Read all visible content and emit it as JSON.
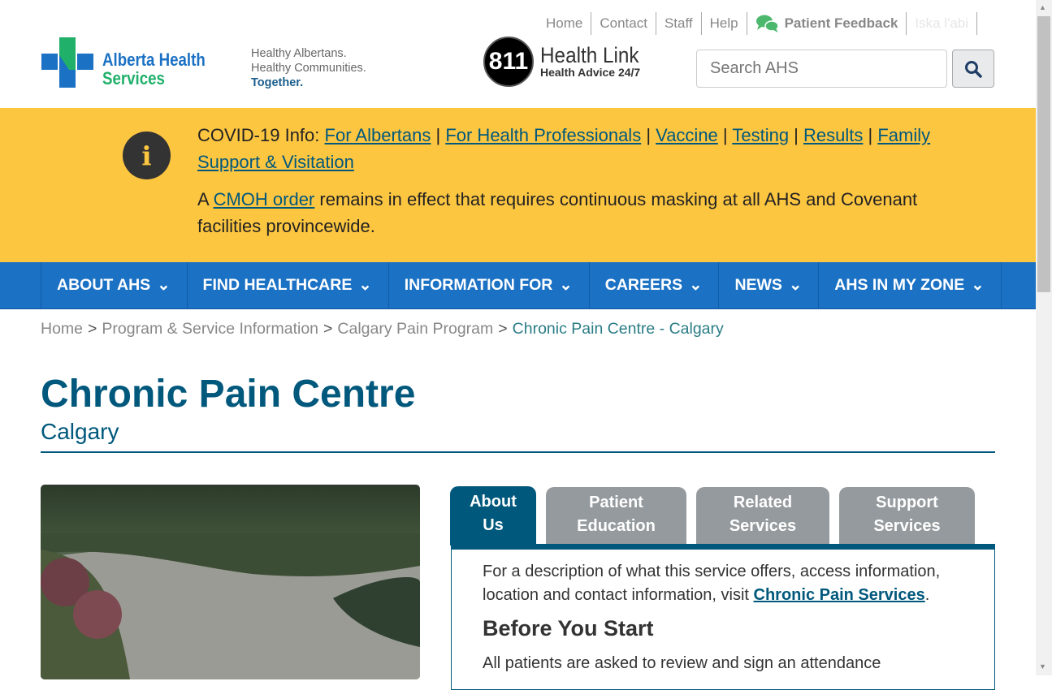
{
  "top_links": [
    "Home",
    "Contact",
    "Staff",
    "Help"
  ],
  "feedback": "Patient Feedback",
  "language": "Iska l'abi",
  "logo": {
    "line1": "Alberta Health",
    "line2": "Services"
  },
  "tagline": [
    "Healthy Albertans.",
    "Healthy Communities.",
    "Together."
  ],
  "healthlink": {
    "number": "811",
    "title": "Health Link",
    "sub": "Health Advice 24/7"
  },
  "search": {
    "placeholder": "Search AHS"
  },
  "banner": {
    "prefix": "COVID-19 Info: ",
    "links": [
      "For Albertans",
      "For Health Professionals",
      "Vaccine",
      "Testing",
      "Results",
      "Family Support & Visitation"
    ],
    "p2_a": "A ",
    "p2_link": "CMOH order",
    "p2_b": " remains in effect that requires continuous masking at all AHS and Covenant facilities provincewide."
  },
  "nav": [
    "ABOUT AHS",
    "FIND HEALTHCARE",
    "INFORMATION FOR",
    "CAREERS",
    "NEWS",
    "AHS IN MY ZONE"
  ],
  "breadcrumb": [
    "Home",
    "Program & Service Information",
    "Calgary Pain Program",
    "Chronic Pain Centre - Calgary"
  ],
  "page": {
    "title": "Chronic Pain Centre",
    "subtitle": "Calgary"
  },
  "tabs": [
    [
      "About",
      "Us"
    ],
    [
      "Patient",
      "Education"
    ],
    [
      "Related",
      "Services"
    ],
    [
      "Support",
      "Services"
    ]
  ],
  "panel": {
    "p1": "For a description of what this service offers, access information, location and contact information, visit ",
    "link": "Chronic Pain Services",
    "p1_end": ".",
    "heading": "Before You Start",
    "p2": "All patients are asked to review and sign an attendance"
  },
  "colors": {
    "brand": "#00587c",
    "nav": "#1b71c4",
    "banner": "#fdc641",
    "feedback_icon": "#4cb86d"
  }
}
